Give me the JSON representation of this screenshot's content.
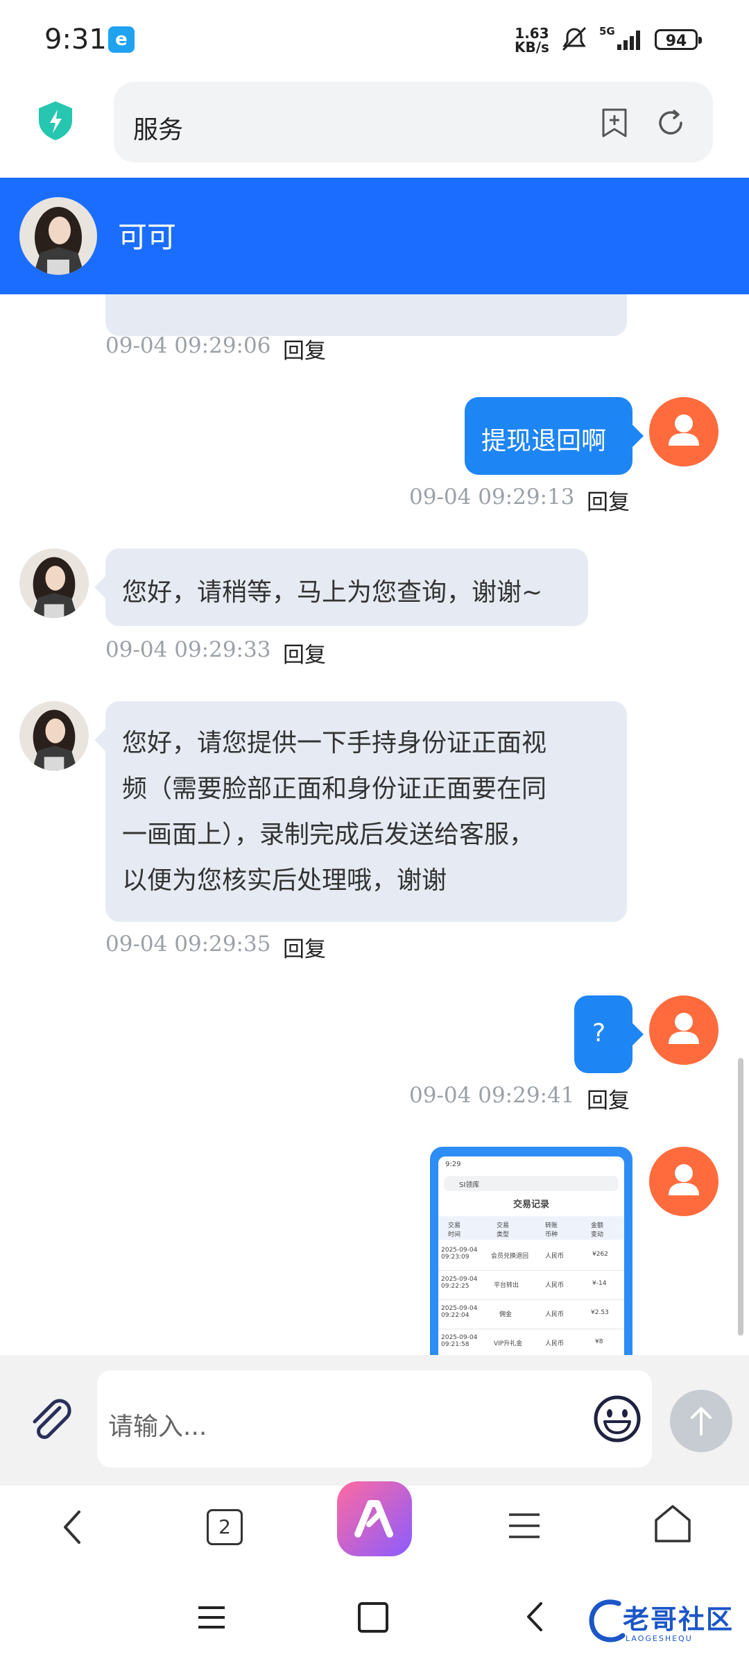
{
  "status_bar": {
    "time": "9:31",
    "app_badge": "e",
    "net_speed_value": "1.63",
    "net_speed_unit": "KB/s",
    "network": "5G",
    "battery": "94"
  },
  "browser": {
    "page_title": "服务"
  },
  "chat_header": {
    "contact_name": "可可"
  },
  "messages": [
    {
      "side": "left",
      "text": "",
      "time": "09-04 09:29:06",
      "reply": "回复"
    },
    {
      "side": "right",
      "text": "提现退回啊",
      "time": "09-04 09:29:13",
      "reply": "回复"
    },
    {
      "side": "left",
      "text": "您好，请稍等，马上为您查询，谢谢~",
      "time": "09-04 09:29:33",
      "reply": "回复"
    },
    {
      "side": "left",
      "lines": [
        "您好，请您提供一下手持身份证正面视",
        "频（需要脸部正面和身份证正面要在同",
        "一画面上），录制完成后发送给客服，",
        "以便为您核实后处理哦，谢谢"
      ],
      "time": "09-04 09:29:35",
      "reply": "回复"
    },
    {
      "side": "right",
      "text": "?",
      "time": "09-04 09:29:41",
      "reply": "回复"
    },
    {
      "side": "right",
      "type": "image"
    }
  ],
  "screenshot_preview": {
    "time": "9:29",
    "url": "SI领库",
    "title": "交易记录",
    "headers": [
      "交易\n时间",
      "交易\n类型",
      "转账\n币种",
      "金额\n变动"
    ],
    "rows": [
      [
        "2025-09-04\n09:23:09",
        "会员兑换退回",
        "人民币",
        "¥262"
      ],
      [
        "2025-09-04\n09:22:25",
        "平台转出",
        "人民币",
        "¥-14"
      ],
      [
        "2025-09-04\n09:22:04",
        "佣金",
        "人民币",
        "¥2.53"
      ],
      [
        "2025-09-04\n09:21:58",
        "VIP升礼金",
        "人民币",
        "¥8"
      ]
    ]
  },
  "input": {
    "placeholder": "请输入..."
  },
  "nav": {
    "tab_count": "2"
  },
  "watermark": {
    "text": "老哥社区",
    "sub": "LAOGESHEQU"
  },
  "colors": {
    "header_blue": "#1a6dff",
    "bubble_blue": "#1e85f5",
    "bubble_gray": "#e6ebf3",
    "user_avatar": "#ff6b3d"
  }
}
